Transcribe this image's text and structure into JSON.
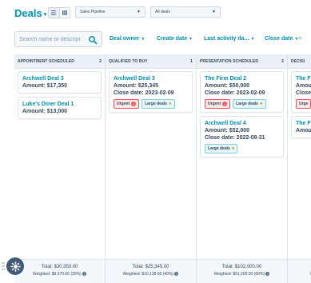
{
  "header": {
    "title": "Deals",
    "view_toggle": [
      "list-icon",
      "board-icon"
    ],
    "pipeline_select": "Sales Pipeline",
    "deals_select": "All deals"
  },
  "filters": {
    "search_placeholder": "Search name or descript",
    "items": [
      "Deal owner",
      "Create date",
      "Last activity da...",
      "Close date"
    ],
    "more": "≡"
  },
  "columns": [
    {
      "title": "APPOINTMENT SCHEDULED",
      "count": "2",
      "total": "Total: $30,350.00",
      "weighted": "Weighted: $6,070.00 (20%)",
      "cards": [
        {
          "name": "Archwell Deal 3",
          "lines": [
            "Amount: $17,350"
          ],
          "tags": []
        },
        {
          "name": "Luke's Diner Deal 1",
          "lines": [
            "Amount: $13,000"
          ],
          "tags": []
        }
      ]
    },
    {
      "title": "QUALIFIED TO BUY",
      "count": "1",
      "total": "Total: $25,345.00",
      "weighted": "Weighted: $10,138.00 (40%)",
      "cards": [
        {
          "name": "Archwell Deal 3",
          "lines": [
            "Amount: $25,345",
            "Close date: 2023-02-09"
          ],
          "tags": [
            "Urgent",
            "Large deals"
          ]
        }
      ]
    },
    {
      "title": "PRESENTATION SCHEDULED",
      "count": "2",
      "total": "Total: $102,000.00",
      "weighted": "Weighted: $61,200.00 (60%)",
      "cards": [
        {
          "name": "The Firm Deal 2",
          "lines": [
            "Amount: $50,000",
            "Close date: 2023-02-09"
          ],
          "tags": [
            "Urgent",
            "Large deals"
          ]
        },
        {
          "name": "Archwell Deal 4",
          "lines": [
            "Amount: $52,000",
            "Close date: 2022-08-31"
          ],
          "tags": [
            "Large deals"
          ]
        }
      ]
    },
    {
      "title": "DECISI",
      "count": "",
      "total": "",
      "weighted": "W",
      "cards": [
        {
          "name": "The F",
          "lines": [
            "Amou",
            "Close"
          ],
          "tags": [
            "Urge"
          ]
        },
        {
          "name": "The F",
          "lines": [
            "Amou"
          ],
          "tags": []
        }
      ]
    }
  ],
  "colors": {
    "link": "#0091ae",
    "text": "#33475b",
    "urgent": "#f2545b",
    "large_deal": "#7fd1de",
    "fab": "#425b76"
  }
}
